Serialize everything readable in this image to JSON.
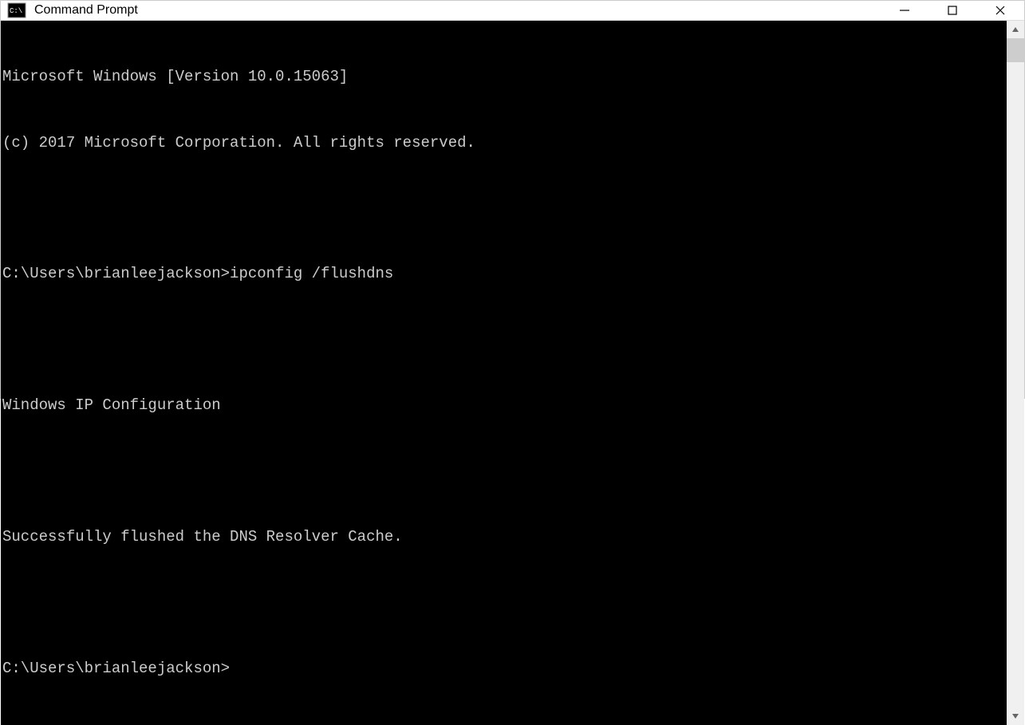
{
  "titlebar": {
    "title": "Command Prompt"
  },
  "terminal": {
    "lines": [
      "Microsoft Windows [Version 10.0.15063]",
      "(c) 2017 Microsoft Corporation. All rights reserved.",
      "",
      "C:\\Users\\brianleejackson>ipconfig /flushdns",
      "",
      "Windows IP Configuration",
      "",
      "Successfully flushed the DNS Resolver Cache.",
      "",
      "C:\\Users\\brianleejackson>"
    ]
  }
}
